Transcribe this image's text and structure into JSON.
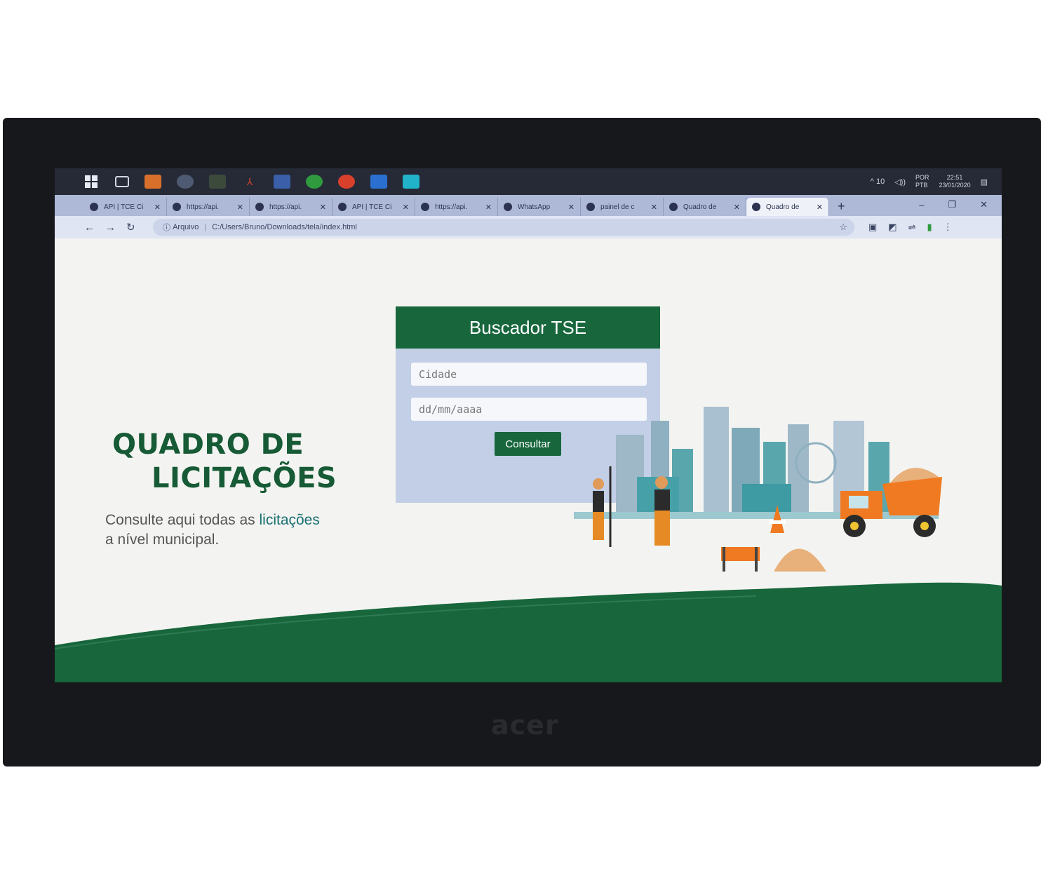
{
  "taskbar": {
    "tray": {
      "tray_text": "^ 10",
      "lang_top": "POR",
      "lang_bottom": "PTB",
      "time": "22:51",
      "date": "23/01/2020"
    }
  },
  "browser": {
    "tabs": [
      {
        "label": "API | TCE Ci",
        "active": false
      },
      {
        "label": "https://api.",
        "active": false
      },
      {
        "label": "https://api.",
        "active": false
      },
      {
        "label": "API | TCE Ci",
        "active": false
      },
      {
        "label": "https://api.",
        "active": false
      },
      {
        "label": "WhatsApp",
        "active": false
      },
      {
        "label": "painel de c",
        "active": false
      },
      {
        "label": "Quadro de",
        "active": false
      },
      {
        "label": "Quadro de",
        "active": true
      }
    ],
    "new_tab": "+",
    "address": {
      "protocol": "Arquivo",
      "url": "C:/Users/Bruno/Downloads/tela/index.html"
    }
  },
  "page": {
    "title_line1": "QUADRO DE",
    "title_line2": "LICITAÇÕES",
    "subtitle_pre": "Consulte aqui todas as",
    "subtitle_highlight": "licitações",
    "subtitle_post": "a nível  municipal.",
    "search_card": {
      "title": "Buscador TSE",
      "city_placeholder": "Cidade",
      "date_placeholder": "dd/mm/aaaa",
      "button_label": "Consultar"
    }
  },
  "colors": {
    "brand_green": "#17663c",
    "title_green": "#165a36",
    "card_bg": "#c2cfe6",
    "highlight_teal": "#1b6f73"
  },
  "laptop": {
    "brand": "acer"
  }
}
